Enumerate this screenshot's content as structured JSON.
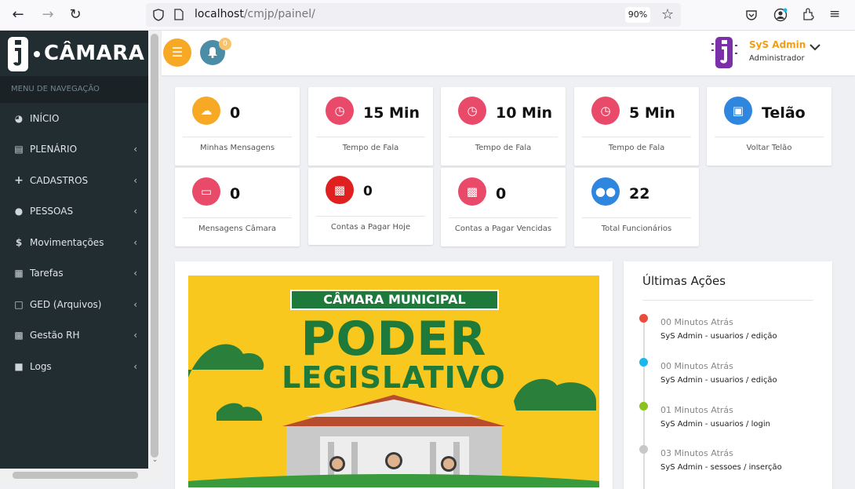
{
  "browser": {
    "url_host": "localhost",
    "url_path": "/cmjp/painel/",
    "zoom": "90%"
  },
  "sidebar": {
    "logo_text": "CÂMARA",
    "nav_header": "MENU DE NAVEGAÇÃO",
    "items": [
      {
        "label": "INÍCIO",
        "icon": "dashboard-icon",
        "has_children": false
      },
      {
        "label": "PLENÁRIO",
        "icon": "institution-icon",
        "has_children": true
      },
      {
        "label": "CADASTROS",
        "icon": "plus-icon",
        "has_children": true
      },
      {
        "label": "PESSOAS",
        "icon": "user-icon",
        "has_children": true
      },
      {
        "label": "Movimentações",
        "icon": "dollar-icon",
        "has_children": true
      },
      {
        "label": "Tarefas",
        "icon": "calendar-icon",
        "has_children": true
      },
      {
        "label": "GED (Arquivos)",
        "icon": "file-icon",
        "has_children": true
      },
      {
        "label": "Gestão RH",
        "icon": "id-card-icon",
        "has_children": true
      },
      {
        "label": "Logs",
        "icon": "lock-icon",
        "has_children": true
      }
    ]
  },
  "topbar": {
    "notification_count": "0",
    "user_name": "SyS Admin",
    "user_role": "Administrador"
  },
  "stats": [
    {
      "value": "0",
      "label": "Minhas Mensagens",
      "color": "#f7a825",
      "icon": "comments-icon"
    },
    {
      "value": "15 Min",
      "label": "Tempo de Fala",
      "color": "#ea4a6a",
      "icon": "clock-icon"
    },
    {
      "value": "10 Min",
      "label": "Tempo de Fala",
      "color": "#ea4a6a",
      "icon": "clock-icon"
    },
    {
      "value": "5 Min",
      "label": "Tempo de Fala",
      "color": "#ea4a6a",
      "icon": "clock-icon"
    },
    {
      "value": "Telão",
      "label": "Voltar Telão",
      "color": "#2e86de",
      "icon": "monitor-icon"
    },
    {
      "value": "0",
      "label": "Mensagens Câmara",
      "color": "#ea4a6a",
      "icon": "laptop-icon"
    },
    {
      "value": "0",
      "label": "Contas a Pagar Hoje",
      "color": "#e02020",
      "icon": "money-icon"
    },
    {
      "value": "0",
      "label": "Contas a Pagar Vencidas",
      "color": "#ea4a6a",
      "icon": "money-icon"
    },
    {
      "value": "22",
      "label": "Total Funcionários",
      "color": "#2e86de",
      "icon": "users-icon"
    }
  ],
  "banner": {
    "band": "CÂMARA MUNICIPAL",
    "line1": "PODER",
    "line2": "LEGISLATIVO"
  },
  "actions": {
    "title": "Últimas Ações",
    "items": [
      {
        "time": "00 Minutos Atrás",
        "text": "SyS Admin - usuarios / edição",
        "color": "#e74c3c"
      },
      {
        "time": "00 Minutos Atrás",
        "text": "SyS Admin - usuarios / edição",
        "color": "#1ab7ea"
      },
      {
        "time": "01 Minutos Atrás",
        "text": "SyS Admin - usuarios / login",
        "color": "#8cc21f"
      },
      {
        "time": "03 Minutos Atrás",
        "text": "SyS Admin - sessoes / inserção",
        "color": "#c8c8c8"
      }
    ]
  }
}
